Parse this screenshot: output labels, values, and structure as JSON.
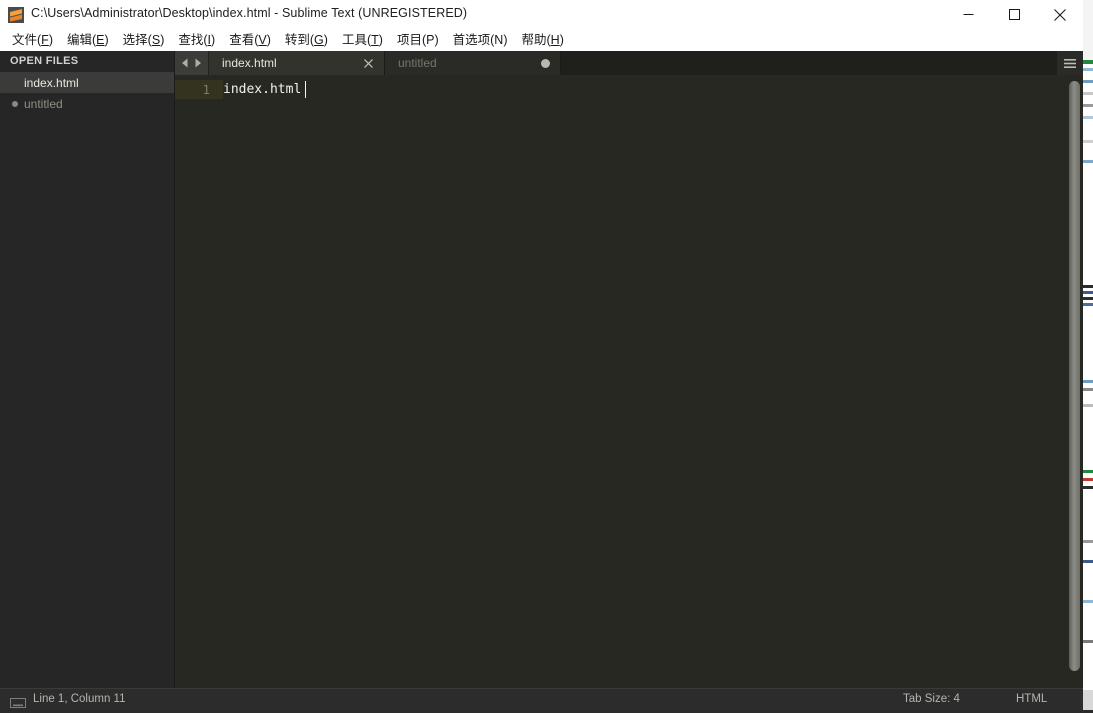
{
  "window": {
    "title": "C:\\Users\\Administrator\\Desktop\\index.html - Sublime Text (UNREGISTERED)",
    "app_icon": "sublime-text-logo-icon",
    "controls": {
      "minimize_label": "Minimize",
      "maximize_label": "Maximize",
      "close_label": "Close"
    }
  },
  "menubar": {
    "items": [
      {
        "label": "文件(F)",
        "text": "文件(",
        "accel": "F",
        "tail": ")"
      },
      {
        "label": "编辑(E)",
        "text": "编辑(",
        "accel": "E",
        "tail": ")"
      },
      {
        "label": "选择(S)",
        "text": "选择(",
        "accel": "S",
        "tail": ")"
      },
      {
        "label": "查找(I)",
        "text": "查找(",
        "accel": "I",
        "tail": ")"
      },
      {
        "label": "查看(V)",
        "text": "查看(",
        "accel": "V",
        "tail": ")"
      },
      {
        "label": "转到(G)",
        "text": "转到(",
        "accel": "G",
        "tail": ")"
      },
      {
        "label": "工具(T)",
        "text": "工具(",
        "accel": "T",
        "tail": ")"
      },
      {
        "label": "项目(P)",
        "text": "项目(",
        "accel": "P",
        "tail": ")"
      },
      {
        "label": "首选项(N)",
        "text": "首选项(",
        "accel": "N",
        "tail": ")"
      },
      {
        "label": "帮助(H)",
        "text": "帮助(",
        "accel": "H",
        "tail": ")"
      }
    ]
  },
  "sidebar": {
    "header": "OPEN FILES",
    "items": [
      {
        "label": "index.html",
        "selected": true,
        "dirty": false
      },
      {
        "label": "untitled",
        "selected": false,
        "dirty": true
      }
    ]
  },
  "tabbar": {
    "prev_arrow": "chevron-left-icon",
    "next_arrow": "chevron-right-icon",
    "menu_icon": "hamburger-menu-icon",
    "tabs": [
      {
        "label": "index.html",
        "active": true,
        "dirty": false,
        "close_icon": "close-icon"
      },
      {
        "label": "untitled",
        "active": false,
        "dirty": true,
        "close_icon": "dirty-dot-icon"
      }
    ]
  },
  "editor": {
    "lines": [
      {
        "number": "1",
        "text": "index.html"
      }
    ],
    "caret_line": "1"
  },
  "statusbar": {
    "keyboard_icon": "keyboard-icon",
    "cursor_position": "Line 1, Column 11",
    "tab_size": "Tab Size: 4",
    "syntax": "HTML"
  },
  "colors": {
    "titlebar_bg": "#ffffff",
    "titlebar_text": "#202020",
    "sidebar_bg": "#262626",
    "tabbar_bg": "#1f1f1c",
    "active_tab_bg": "#33332d",
    "inactive_tab_bg": "#2a2a27",
    "editor_bg": "#272822",
    "editor_text": "#f2f2e8",
    "line_number": "#7d7d63",
    "active_line_gutter": "#33331f",
    "statusbar_bg": "#2c2c2c",
    "statusbar_text": "#b5b5ad",
    "accent_orange": "#e8a33d"
  }
}
